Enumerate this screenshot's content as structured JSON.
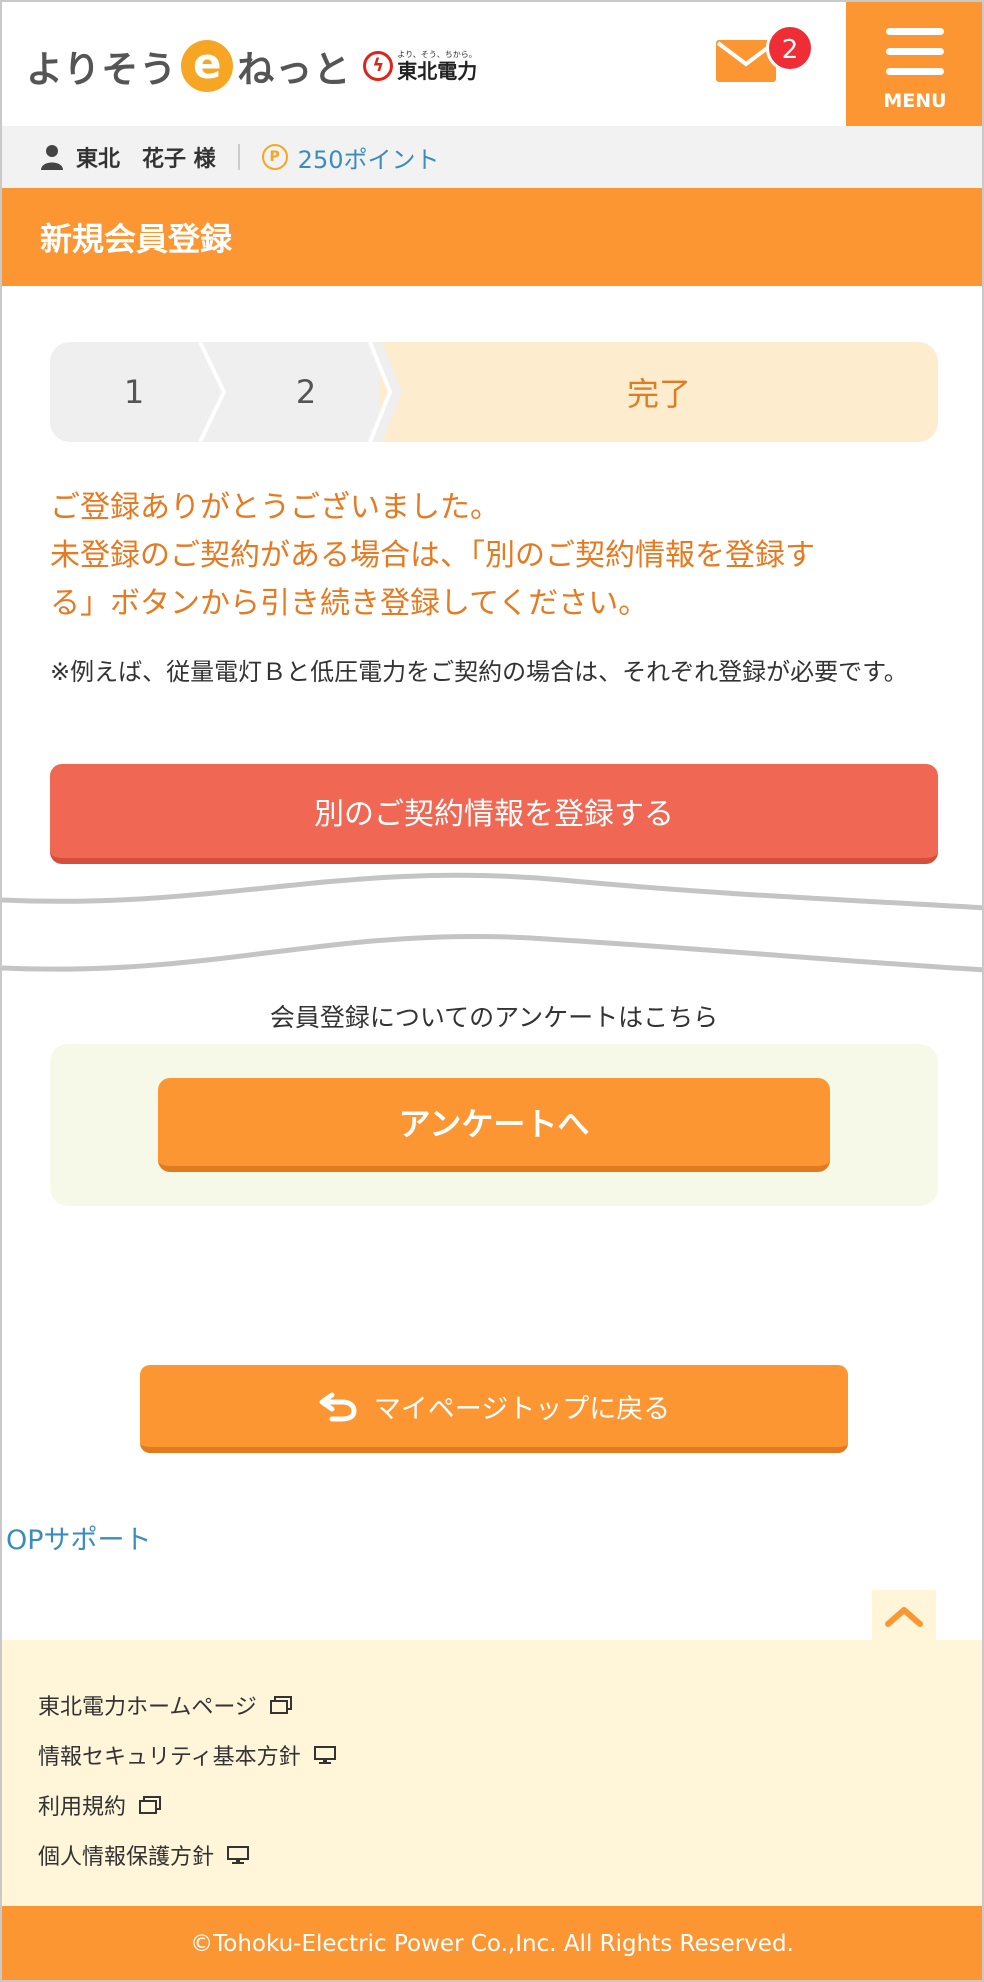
{
  "header": {
    "logo_text_a": "よりそう",
    "logo_e": "e",
    "logo_text_b": "ねっと",
    "logo_tohoku_small": "より、そう、ちから。",
    "logo_tohoku_name": "東北電力",
    "mail_count": "2",
    "menu_label": "MENU"
  },
  "userbar": {
    "user_name": "東北　花子 様",
    "point_icon": "P",
    "points": "250ポイント"
  },
  "page": {
    "title": "新規会員登録"
  },
  "steps": {
    "step1": "1",
    "step2": "2",
    "step3": "完了",
    "current": "完了"
  },
  "message": {
    "line1": "ご登録ありがとうございました。",
    "line2": "未登録のご契約がある場合は、「別のご契約情報を登録す",
    "line3": "る」ボタンから引き続き登録してください。",
    "note": "※例えば、従量電灯Ｂと低圧電力をご契約の場合は、それぞれ登録が必要です。"
  },
  "buttons": {
    "register_another": "別のご契約情報を登録する",
    "survey_label": "会員登録についてのアンケートはこちら",
    "survey": "アンケートへ",
    "back_mypage": "マイページトップに戻る"
  },
  "links": {
    "support": "OPサポート"
  },
  "footer": {
    "links": [
      {
        "label": "東北電力ホームページ",
        "icon": "external-window-icon"
      },
      {
        "label": "情報セキュリティ基本方針",
        "icon": "monitor-icon"
      },
      {
        "label": "利用規約",
        "icon": "external-window-icon"
      },
      {
        "label": "個人情報保護方針",
        "icon": "monitor-icon"
      }
    ],
    "copyright": "©Tohoku-Electric Power Co.,Inc. All Rights Reserved."
  },
  "colors": {
    "brand_orange": "#fb9633",
    "accent_red": "#f06753",
    "message_orange": "#e77a20",
    "link_blue": "#3a8cbd"
  }
}
